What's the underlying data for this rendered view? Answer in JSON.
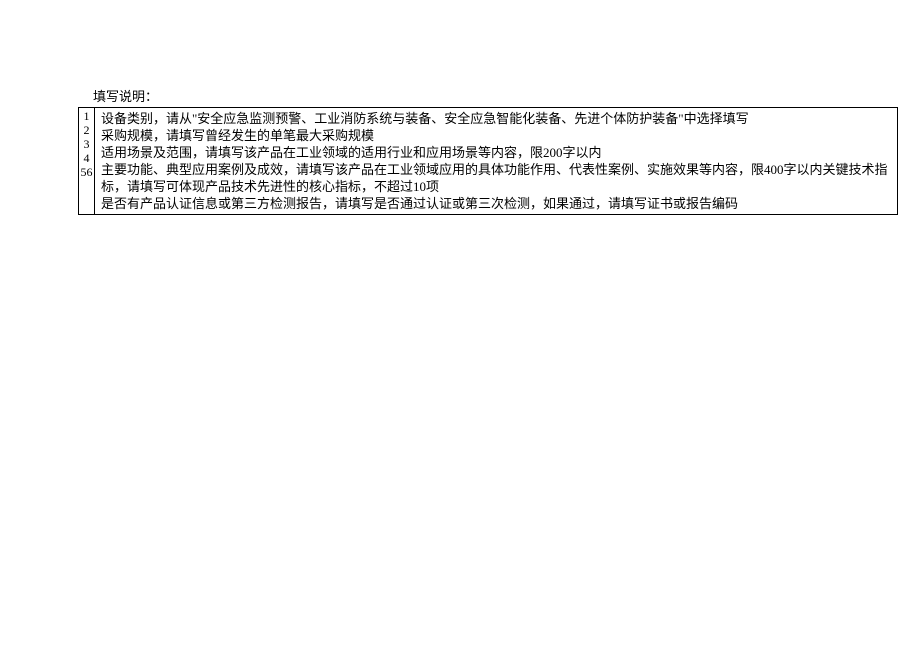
{
  "title": "填写说明：",
  "numbers": [
    "1",
    "2",
    "3",
    "4",
    "56"
  ],
  "items": [
    "设备类别，请从\"安全应急监测预警、工业消防系统与装备、安全应急智能化装备、先进个体防护装备\"中选择填写",
    "采购规模，请填写曾经发生的单笔最大采购规模",
    "适用场景及范围，请填写该产品在工业领域的适用行业和应用场景等内容，限200字以内",
    "主要功能、典型应用案例及成效，请填写该产品在工业领域应用的具体功能作用、代表性案例、实施效果等内容，限400字以内关键技术指标，请填写可体现产品技术先进性的核心指标，不超过10项",
    "是否有产品认证信息或第三方检测报告，请填写是否通过认证或第三次检测，如果通过，请填写证书或报告编码"
  ]
}
